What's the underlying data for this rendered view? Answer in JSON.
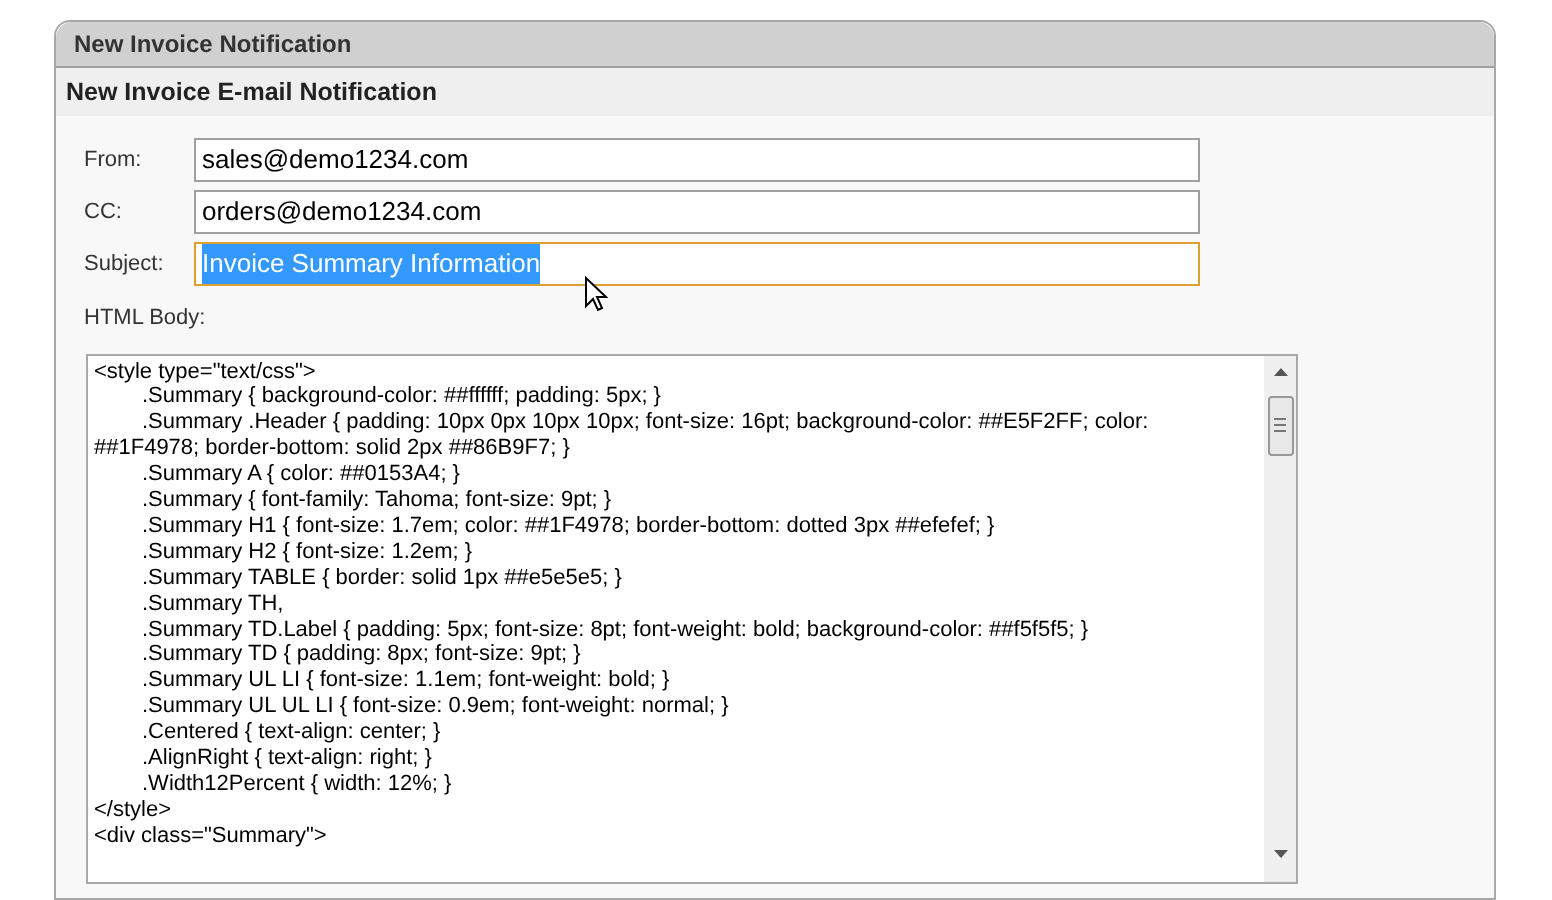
{
  "panel": {
    "title": "New Invoice Notification"
  },
  "section": {
    "title": "New Invoice E-mail Notification"
  },
  "fields": [
    {
      "label": "From:",
      "value": "sales@demo1234.com",
      "focused": false,
      "text_selected": false
    },
    {
      "label": "CC:",
      "value": "orders@demo1234.com",
      "focused": false,
      "text_selected": false
    },
    {
      "label": "Subject:",
      "value": "Invoice Summary Information",
      "focused": true,
      "text_selected": true
    }
  ],
  "html_body": {
    "label": "HTML Body:",
    "lines": [
      {
        "text": "<style type=\"text/css\">",
        "indented": false
      },
      {
        "text": ".Summary { background-color: ##ffffff; padding: 5px; }",
        "indented": true
      },
      {
        "text": ".Summary .Header { padding: 10px 0px 10px 10px; font-size: 16pt; background-color: ##E5F2FF; color: ##1F4978; border-bottom: solid 2px ##86B9F7; }",
        "indented": true
      },
      {
        "text": ".Summary A { color: ##0153A4; }",
        "indented": true
      },
      {
        "text": ".Summary { font-family: Tahoma; font-size: 9pt; }",
        "indented": true
      },
      {
        "text": ".Summary H1 { font-size: 1.7em; color: ##1F4978; border-bottom: dotted 3px ##efefef; }",
        "indented": true
      },
      {
        "text": ".Summary H2 { font-size: 1.2em; }",
        "indented": true
      },
      {
        "text": ".Summary TABLE { border: solid 1px ##e5e5e5; }",
        "indented": true
      },
      {
        "text": ".Summary TH,",
        "indented": true
      },
      {
        "text": ".Summary TD.Label { padding: 5px; font-size: 8pt; font-weight: bold; background-color: ##f5f5f5; }",
        "indented": true
      },
      {
        "text": ".Summary TD { padding: 8px; font-size: 9pt; }",
        "indented": true
      },
      {
        "text": ".Summary UL LI { font-size: 1.1em; font-weight: bold; }",
        "indented": true
      },
      {
        "text": ".Summary UL UL LI { font-size: 0.9em; font-weight: normal; }",
        "indented": true
      },
      {
        "text": ".Centered { text-align: center; }",
        "indented": true
      },
      {
        "text": ".AlignRight { text-align: right; }",
        "indented": true
      },
      {
        "text": ".Width12Percent { width: 12%; }",
        "indented": true
      },
      {
        "text": "</style>",
        "indented": false
      },
      {
        "text": "<div class=\"Summary\">",
        "indented": false
      }
    ]
  }
}
